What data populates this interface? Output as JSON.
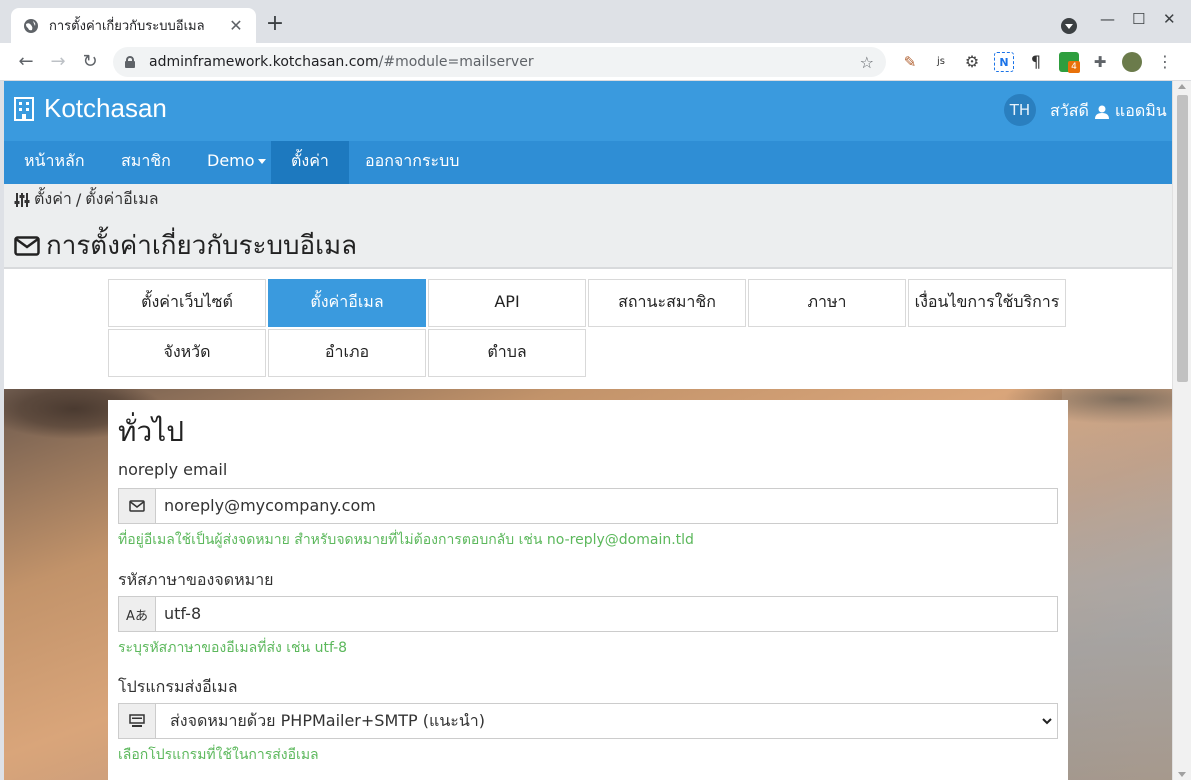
{
  "browser": {
    "tab_title": "การตั้งค่าเกี่ยวกับระบบอีเมล",
    "url_host": "adminframework.kotchasan.com",
    "url_path": "/#module=mailserver",
    "ext_badge": "4"
  },
  "header": {
    "brand": "Kotchasan",
    "lang": "TH",
    "greeting": "สวัสดี",
    "username": "แอดมิน"
  },
  "nav": {
    "items": [
      {
        "label": "หน้าหลัก"
      },
      {
        "label": "สมาชิก"
      },
      {
        "label": "Demo"
      },
      {
        "label": "ตั้งค่า"
      },
      {
        "label": "ออกจากระบบ"
      }
    ]
  },
  "breadcrumb": {
    "parent": "ตั้งค่า",
    "separator": "/",
    "current": "ตั้งค่าอีเมล"
  },
  "page": {
    "title": "การตั้งค่าเกี่ยวกับระบบอีเมล"
  },
  "settings_tabs": [
    {
      "label": "ตั้งค่าเว็บไซต์"
    },
    {
      "label": "ตั้งค่าอีเมล"
    },
    {
      "label": "API"
    },
    {
      "label": "สถานะสมาชิก"
    },
    {
      "label": "ภาษา"
    },
    {
      "label": "เงื่อนไขการใช้บริการ"
    },
    {
      "label": "จังหวัด"
    },
    {
      "label": "อำเภอ"
    },
    {
      "label": "ตำบล"
    }
  ],
  "form": {
    "section_title": "ทั่วไป",
    "noreply": {
      "label": "noreply email",
      "value": "noreply@mycompany.com",
      "hint": "ที่อยู่อีเมลใช้เป็นผู้ส่งจดหมาย สำหรับจดหมายที่ไม่ต้องการตอบกลับ เช่น no-reply@domain.tld"
    },
    "charset": {
      "label": "รหัสภาษาของจดหมาย",
      "addon": "Aあ",
      "value": "utf-8",
      "hint": "ระบุรหัสภาษาของอีเมลที่ส่ง เช่น utf-8"
    },
    "mailer": {
      "label": "โปรแกรมส่งอีเมล",
      "value": "ส่งจดหมายด้วย PHPMailer+SMTP (แนะนำ)",
      "hint": "เลือกโปรแกรมที่ใช้ในการส่งอีเมล"
    }
  },
  "colors": {
    "primary": "#3a9ade",
    "nav": "#2f8ed5",
    "hint": "#5cb85c"
  }
}
